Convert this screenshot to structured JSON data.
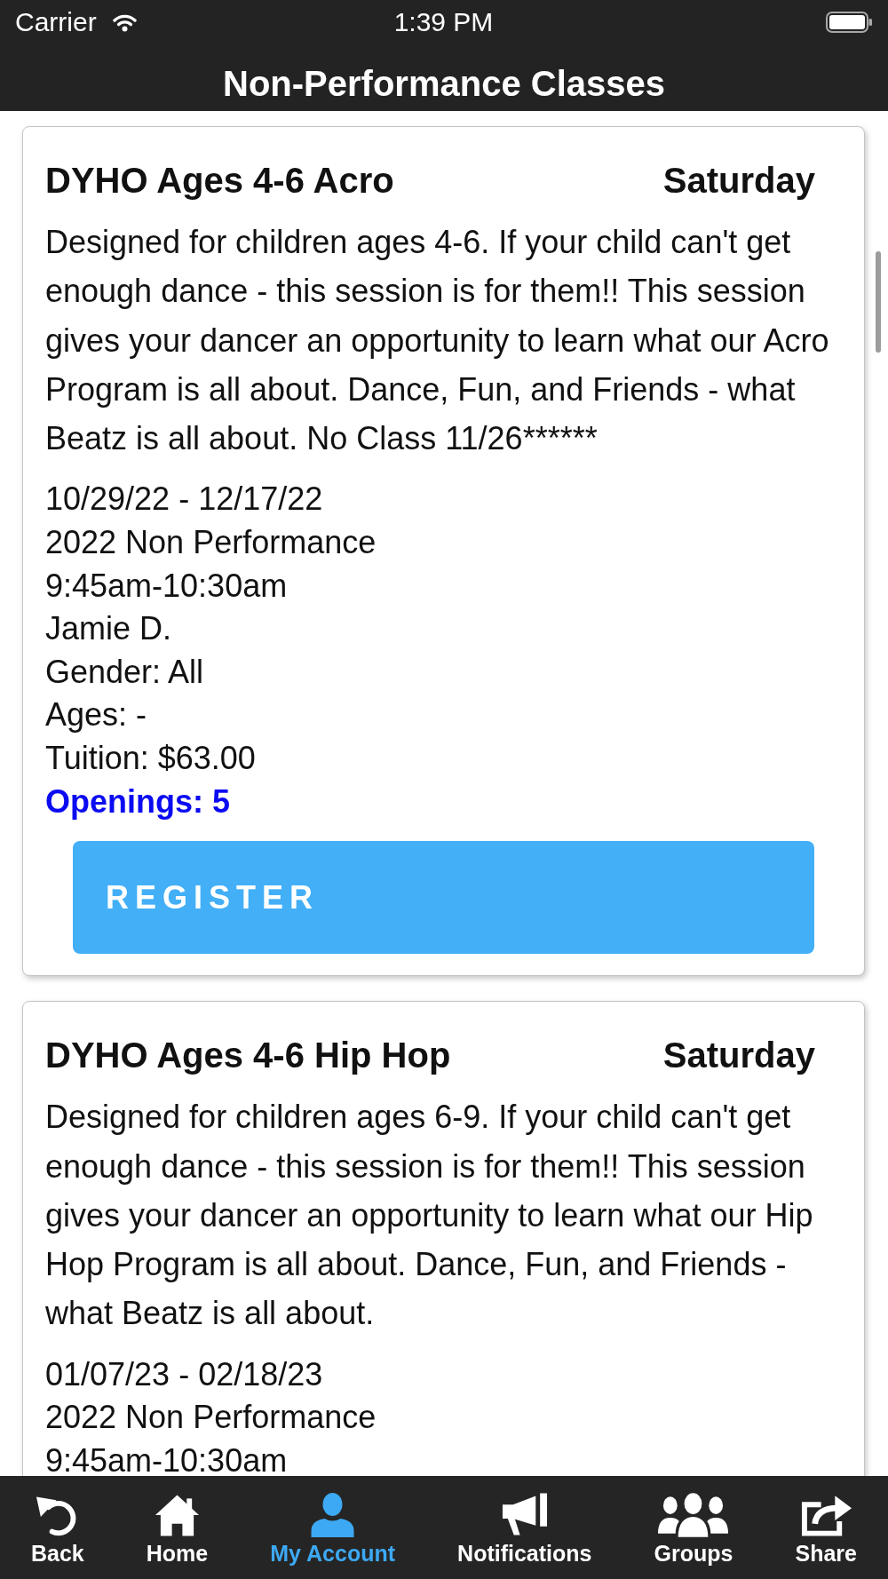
{
  "status_bar": {
    "carrier": "Carrier",
    "time": "1:39 PM"
  },
  "nav_bar": {
    "title": "Non-Performance Classes"
  },
  "classes": [
    {
      "title": "DYHO Ages 4-6 Acro",
      "day": "Saturday",
      "description": "Designed for children ages 4-6. If your child can't get enough dance - this session is for them!! This session gives your dancer an opportunity to learn what our Acro Program is all about. Dance, Fun, and Friends - what Beatz is all about. No Class 11/26******",
      "dates": "10/29/22 - 12/17/22",
      "season": "2022 Non Performance",
      "time": "9:45am-10:30am",
      "instructor": "Jamie D.",
      "gender": "Gender: All",
      "ages": "Ages: -",
      "tuition": "Tuition: $63.00",
      "openings": "Openings: 5",
      "register_label": "REGISTER"
    },
    {
      "title": "DYHO Ages 4-6 Hip Hop",
      "day": "Saturday",
      "description": "Designed for children ages 6-9. If your child can't get enough dance - this session is for them!! This session gives your dancer an opportunity to learn what our Hip Hop Program is all about. Dance, Fun, and Friends - what Beatz is all about.",
      "dates": "01/07/23 - 02/18/23",
      "season": "2022 Non Performance",
      "time": "9:45am-10:30am"
    }
  ],
  "tab_bar": {
    "items": [
      {
        "kind": "back",
        "label": "Back",
        "selected": false
      },
      {
        "kind": "home",
        "label": "Home",
        "selected": false
      },
      {
        "kind": "account",
        "label": "My Account",
        "selected": true
      },
      {
        "kind": "notifications",
        "label": "Notifications",
        "selected": false
      },
      {
        "kind": "groups",
        "label": "Groups",
        "selected": false
      },
      {
        "kind": "share",
        "label": "Share",
        "selected": false
      }
    ]
  }
}
